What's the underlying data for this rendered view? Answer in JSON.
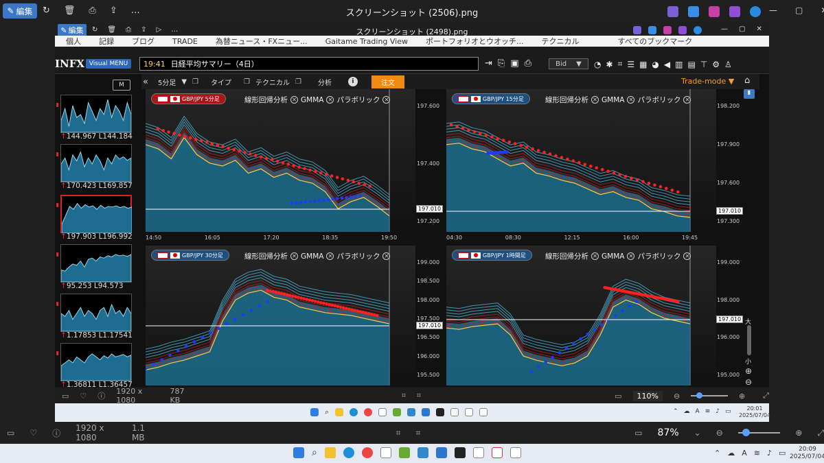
{
  "viewer": {
    "edit_label": "編集",
    "title": "スクリーンショット (2506).png",
    "dims": "1920 x 1080",
    "size": "1.1 MB",
    "zoom": "87%",
    "time": "20:09",
    "date": "2025/07/04"
  },
  "inner_viewer": {
    "edit_label": "編集",
    "title": "スクリーンショット (2498).png",
    "dims": "1920 x 1080",
    "size": "787 KB",
    "zoom": "110%",
    "time": "20:01",
    "date": "2025/07/04"
  },
  "bookmarks": [
    "個人",
    "記録",
    "ブログ",
    "TRADE",
    "為替ニュース・FXニュー...",
    "Gaitame Trading View",
    "ポートフォリオとウオッチ...",
    "テクニカル",
    "すべてのブックマーク"
  ],
  "app": {
    "logo": "INFX",
    "visual_menu": "Visual MENU",
    "news_time": "19:41",
    "news_text": "日経平均サマリー（4日）",
    "bid_label": "Bid",
    "m_button": "M"
  },
  "toolbar": {
    "timeframe": "5分足",
    "type": "タイプ",
    "technical": "テクニカル",
    "analysis": "分析",
    "order": "注文",
    "trade_mode": "Trade-mode ▼"
  },
  "sidebar": [
    {
      "h": "144.967",
      "l": "L144.184"
    },
    {
      "h": "170.423",
      "l": "L169.857"
    },
    {
      "h": "197.903",
      "l": "L196.992"
    },
    {
      "h": "95.253",
      "l": "L94.573"
    },
    {
      "h": "1.17853",
      "l": "L1.17541"
    },
    {
      "h": "1.36811",
      "l": "L1.36457"
    }
  ],
  "indicators": {
    "regression": "線形回帰分析",
    "gmma": "GMMA",
    "parabolic": "パラボリック"
  },
  "charts": [
    {
      "pair": "GBP/JPY 5分足",
      "pill_color": "#a81717",
      "price": "197.010",
      "y_ticks": [
        "197.600",
        "197.400",
        "197.200"
      ],
      "x_ticks": [
        "14:50",
        "16:05",
        "17:20",
        "18:35",
        "19:50"
      ]
    },
    {
      "pair": "GBP/JPY 15分足",
      "pill_color": "#1d4f80",
      "price": "197.010",
      "y_ticks": [
        "198.200",
        "197.900",
        "197.600",
        "197.300"
      ],
      "x_ticks": [
        "04:30",
        "08:30",
        "12:15",
        "16:00",
        "19:45"
      ]
    },
    {
      "pair": "GBP/JPY 30分足",
      "pill_color": "#1d4f80",
      "price": "197.010",
      "y_ticks": [
        "199.000",
        "198.500",
        "198.000",
        "197.500",
        "196.500",
        "196.000",
        "195.500"
      ],
      "x_ticks": []
    },
    {
      "pair": "GBP/JPY 1時間足",
      "pill_color": "#1d4f80",
      "price": "197.010",
      "y_ticks": [
        "199.000",
        "198.000",
        "196.000",
        "195.000"
      ],
      "x_ticks": []
    }
  ],
  "zoom_labels": {
    "large": "大",
    "small": "小"
  }
}
